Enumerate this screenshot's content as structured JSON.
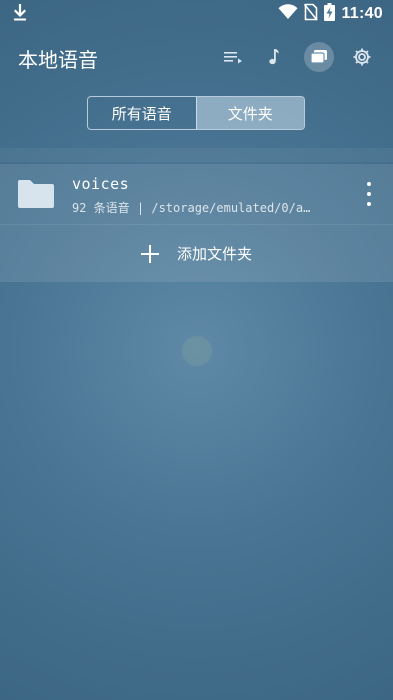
{
  "status_bar": {
    "time": "11:40",
    "icons": [
      "download-icon",
      "wifi-icon",
      "no-sim-icon",
      "battery-charging-icon"
    ]
  },
  "app_bar": {
    "title": "本地语音",
    "actions": [
      "playlist-icon",
      "music-note-icon",
      "folder-stack-icon",
      "settings-icon"
    ],
    "active_action": "folder-stack-icon"
  },
  "tabs": {
    "items": [
      "所有语音",
      "文件夹"
    ],
    "selected": "文件夹"
  },
  "folders": [
    {
      "name": "voices",
      "meta": "92 条语音 | /storage/emulated/0/a…",
      "icon": "folder-icon"
    }
  ],
  "add_folder": {
    "label": "添加文件夹",
    "icon": "plus-icon"
  },
  "colors": {
    "background": "#4a7594",
    "folder_icon": "#d7e4ee",
    "tab_border": "#dcebf5"
  }
}
